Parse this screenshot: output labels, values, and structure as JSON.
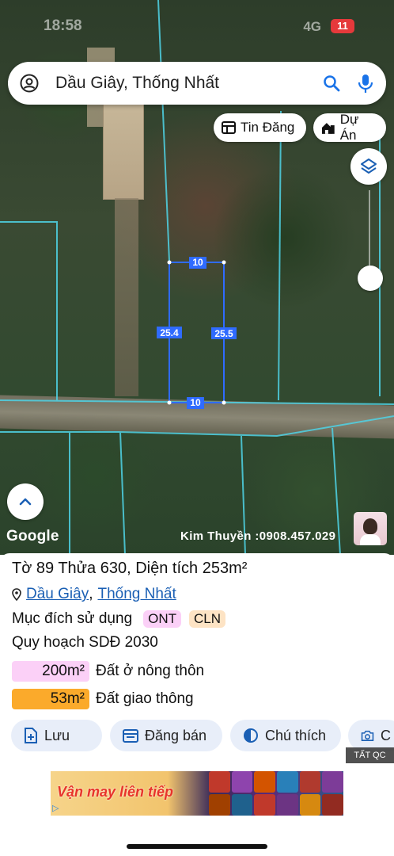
{
  "status": {
    "time": "18:58",
    "network": "4G",
    "battery": "11"
  },
  "search": {
    "query": "Dầu Giây, Thống Nhất"
  },
  "chips": {
    "listing": "Tin Đăng",
    "project": "Dự Án"
  },
  "map": {
    "dims": {
      "top": "10",
      "bottom": "10",
      "left": "25.4",
      "right": "25.5"
    },
    "attribution": "Google",
    "contact": "Kim Thuyền :0908.457.029"
  },
  "parcel": {
    "title": "Tờ 89 Thửa 630, Diện tích 253m²",
    "district": "Dầu Giây",
    "commune": "Thống Nhất",
    "separator": ",",
    "purpose_label": "Mục đích sử dụng",
    "purpose_codes": [
      "ONT",
      "CLN"
    ],
    "plan_label": "Quy hoạch SDĐ 2030",
    "zones": [
      {
        "area": "200m²",
        "label": "Đất ở nông thôn",
        "color": "#fbd0f7"
      },
      {
        "area": "53m²",
        "label": "Đất giao thông",
        "color": "#fbaa2b"
      }
    ]
  },
  "actions": {
    "save": "Lưu",
    "sell": "Đăng bán",
    "legend": "Chú thích",
    "photo": "C"
  },
  "ad": {
    "close_label": "TẤT QC",
    "banner_text": "Vận may liên tiếp"
  },
  "colors": {
    "accent": "#1a73e8",
    "parcel_line": "#2f6bff",
    "ont_badge": "#fbd0f7",
    "cln_badge": "#fde3c4"
  }
}
